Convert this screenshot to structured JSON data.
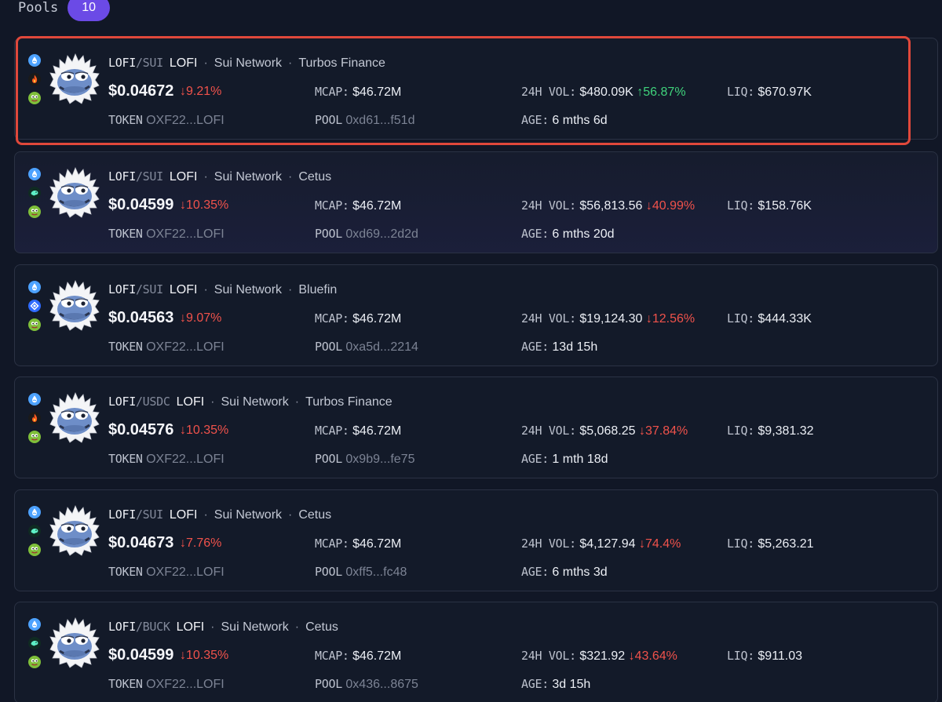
{
  "header": {
    "title": "Pools",
    "count": "10"
  },
  "labels": {
    "mcap": "MCAP:",
    "vol": "24H VOL:",
    "liq": "LIQ:",
    "token": "TOKEN",
    "pool": "POOL",
    "age": "AGE:",
    "dot_sep": "·",
    "slash": "/"
  },
  "colors": {
    "background": "#111726",
    "badge": "#6b4ae6",
    "highlight_border": "#e0483b",
    "negative": "#f0524b",
    "positive": "#3fd27b"
  },
  "pools": [
    {
      "base": "LOFI",
      "quote": "SUI",
      "token_name": "LOFI",
      "network": "Sui Network",
      "dex": "Turbos Finance",
      "dex_icon": "turbos-flame-icon",
      "price": "$0.04672",
      "change": "↓9.21%",
      "change_dir": "down",
      "mcap": "$46.72M",
      "vol": "$480.09K",
      "vol_change": "↑56.87%",
      "vol_dir": "up",
      "liq": "$670.97K",
      "token_addr": "OXF22...LOFI",
      "pool_addr": "0xd61...f51d",
      "age": "6 mths 6d"
    },
    {
      "base": "LOFI",
      "quote": "SUI",
      "token_name": "LOFI",
      "network": "Sui Network",
      "dex": "Cetus",
      "dex_icon": "cetus-icon",
      "price": "$0.04599",
      "change": "↓10.35%",
      "change_dir": "down",
      "mcap": "$46.72M",
      "vol": "$56,813.56",
      "vol_change": "↓40.99%",
      "vol_dir": "down",
      "liq": "$158.76K",
      "token_addr": "OXF22...LOFI",
      "pool_addr": "0xd69...2d2d",
      "age": "6 mths 20d"
    },
    {
      "base": "LOFI",
      "quote": "SUI",
      "token_name": "LOFI",
      "network": "Sui Network",
      "dex": "Bluefin",
      "dex_icon": "bluefin-icon",
      "price": "$0.04563",
      "change": "↓9.07%",
      "change_dir": "down",
      "mcap": "$46.72M",
      "vol": "$19,124.30",
      "vol_change": "↓12.56%",
      "vol_dir": "down",
      "liq": "$444.33K",
      "token_addr": "OXF22...LOFI",
      "pool_addr": "0xa5d...2214",
      "age": "13d 15h"
    },
    {
      "base": "LOFI",
      "quote": "USDC",
      "token_name": "LOFI",
      "network": "Sui Network",
      "dex": "Turbos Finance",
      "dex_icon": "turbos-flame-icon",
      "price": "$0.04576",
      "change": "↓10.35%",
      "change_dir": "down",
      "mcap": "$46.72M",
      "vol": "$5,068.25",
      "vol_change": "↓37.84%",
      "vol_dir": "down",
      "liq": "$9,381.32",
      "token_addr": "OXF22...LOFI",
      "pool_addr": "0x9b9...fe75",
      "age": "1 mth 18d"
    },
    {
      "base": "LOFI",
      "quote": "SUI",
      "token_name": "LOFI",
      "network": "Sui Network",
      "dex": "Cetus",
      "dex_icon": "cetus-icon",
      "price": "$0.04673",
      "change": "↓7.76%",
      "change_dir": "down",
      "mcap": "$46.72M",
      "vol": "$4,127.94",
      "vol_change": "↓74.4%",
      "vol_dir": "down",
      "liq": "$5,263.21",
      "token_addr": "OXF22...LOFI",
      "pool_addr": "0xff5...fc48",
      "age": "6 mths 3d"
    },
    {
      "base": "LOFI",
      "quote": "BUCK",
      "token_name": "LOFI",
      "network": "Sui Network",
      "dex": "Cetus",
      "dex_icon": "cetus-icon",
      "price": "$0.04599",
      "change": "↓10.35%",
      "change_dir": "down",
      "mcap": "$46.72M",
      "vol": "$321.92",
      "vol_change": "↓43.64%",
      "vol_dir": "down",
      "liq": "$911.03",
      "token_addr": "OXF22...LOFI",
      "pool_addr": "0x436...8675",
      "age": "3d 15h"
    }
  ]
}
